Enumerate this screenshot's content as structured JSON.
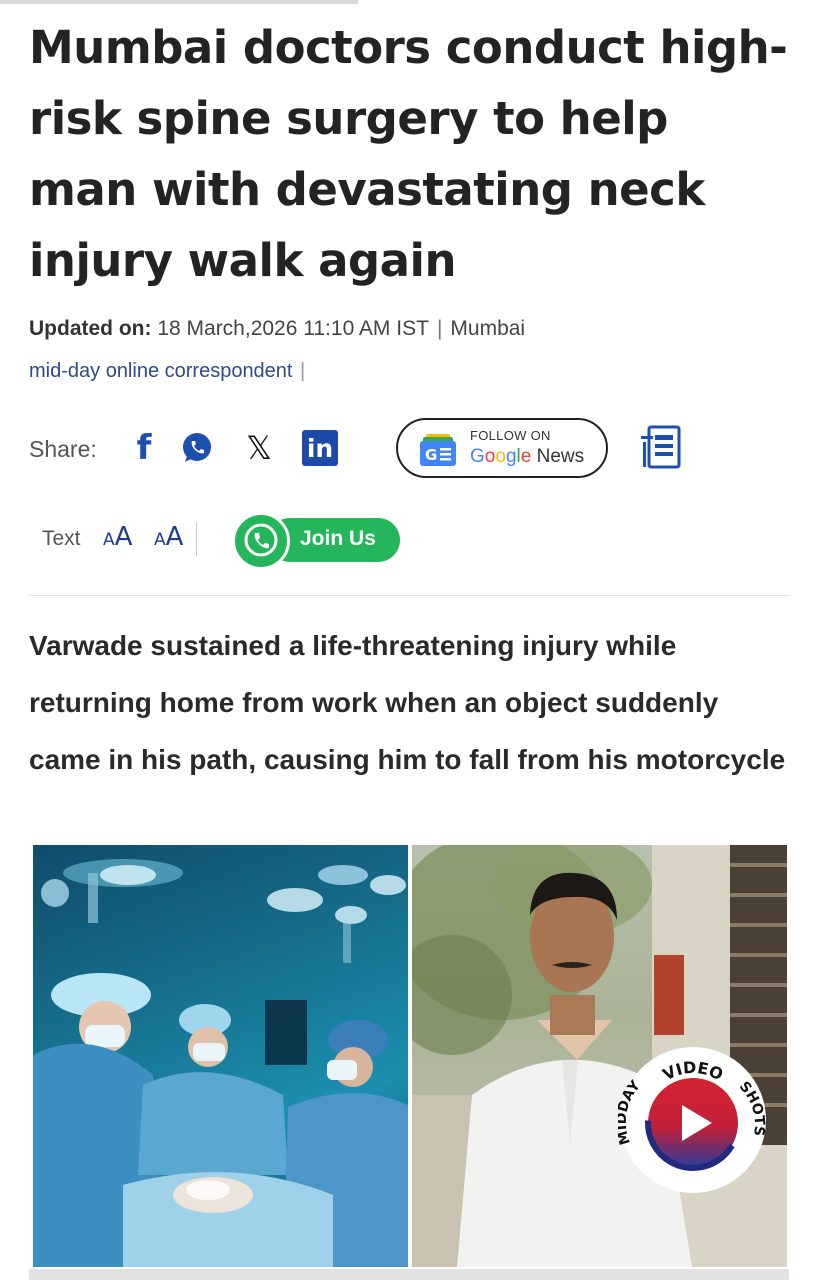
{
  "article": {
    "headline": "Mumbai doctors conduct high-risk spine surgery to help man with devastating neck injury walk again",
    "updated_label": "Updated on:",
    "updated_value": "18 March,2026 11:10 AM IST",
    "location": "Mumbai",
    "byline": "mid-day online correspondent",
    "summary": "Varwade sustained a life-threatening injury while returning home from work when an object suddenly came in his path, causing him to fall from his motorcycle"
  },
  "share": {
    "label": "Share:",
    "icons": [
      "facebook-icon",
      "whatsapp-icon",
      "x-icon",
      "linkedin-icon"
    ]
  },
  "google_news": {
    "follow_label": "FOLLOW ON",
    "google": "Google",
    "news": "News",
    "icon_text": "G☰"
  },
  "text_size": {
    "label": "Text",
    "small": "AA",
    "large": "AA"
  },
  "join": {
    "label": "Join Us"
  },
  "video_badge": {
    "top": "VIDEO",
    "right": "SHOTS",
    "left": "MIDDAY"
  },
  "colors": {
    "link_blue": "#2c4a8c",
    "whatsapp_green": "#25b55a",
    "badge_red": "#d4232f",
    "badge_blue": "#2a3b9c"
  }
}
